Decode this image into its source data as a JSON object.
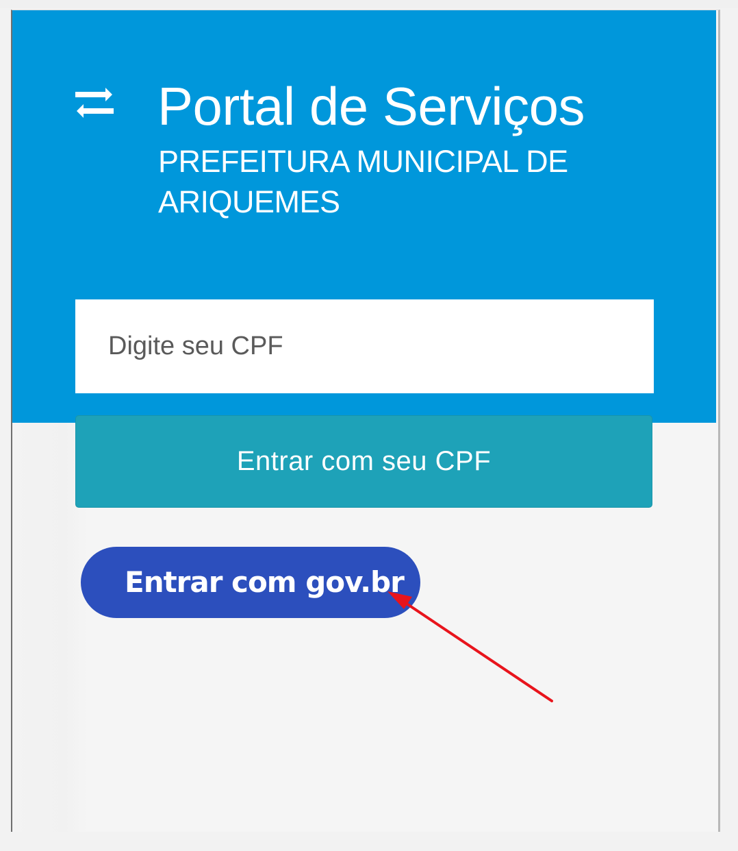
{
  "header": {
    "icon": "swap-arrows-icon",
    "title": "Portal de Serviços",
    "subtitle": "PREFEITURA MUNICIPAL DE ARIQUEMES"
  },
  "login": {
    "cpf_placeholder": "Digite seu CPF",
    "cpf_button_label": "Entrar com seu CPF",
    "govbr_button_label": "Entrar com gov.br"
  },
  "annotation": {
    "icon": "red-arrow-icon"
  },
  "colors": {
    "header_background": "#0097db",
    "cpf_button": "#1ea2b8",
    "govbr_button": "#2c4fbd",
    "annotation_arrow": "#e8141c"
  }
}
